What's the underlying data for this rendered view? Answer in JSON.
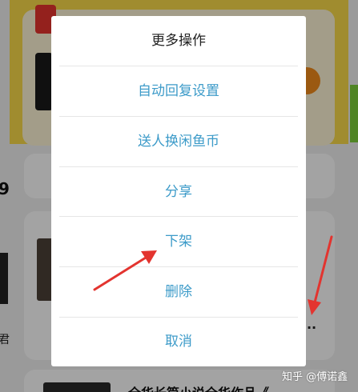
{
  "background": {
    "partial_number": "9",
    "partial_char": "君",
    "more_button_label": "···",
    "bottom_title_fragment": "全华长篇小说全华作品《"
  },
  "dialog": {
    "title": "更多操作",
    "items": [
      {
        "label": "自动回复设置"
      },
      {
        "label": "送人换闲鱼币"
      },
      {
        "label": "分享"
      },
      {
        "label": "下架"
      },
      {
        "label": "删除"
      },
      {
        "label": "取消"
      }
    ]
  },
  "colors": {
    "item_text": "#3d9bc9",
    "title_text": "#222222",
    "arrow": "#e3342f"
  },
  "watermark": "知乎 @傅诺鑫"
}
